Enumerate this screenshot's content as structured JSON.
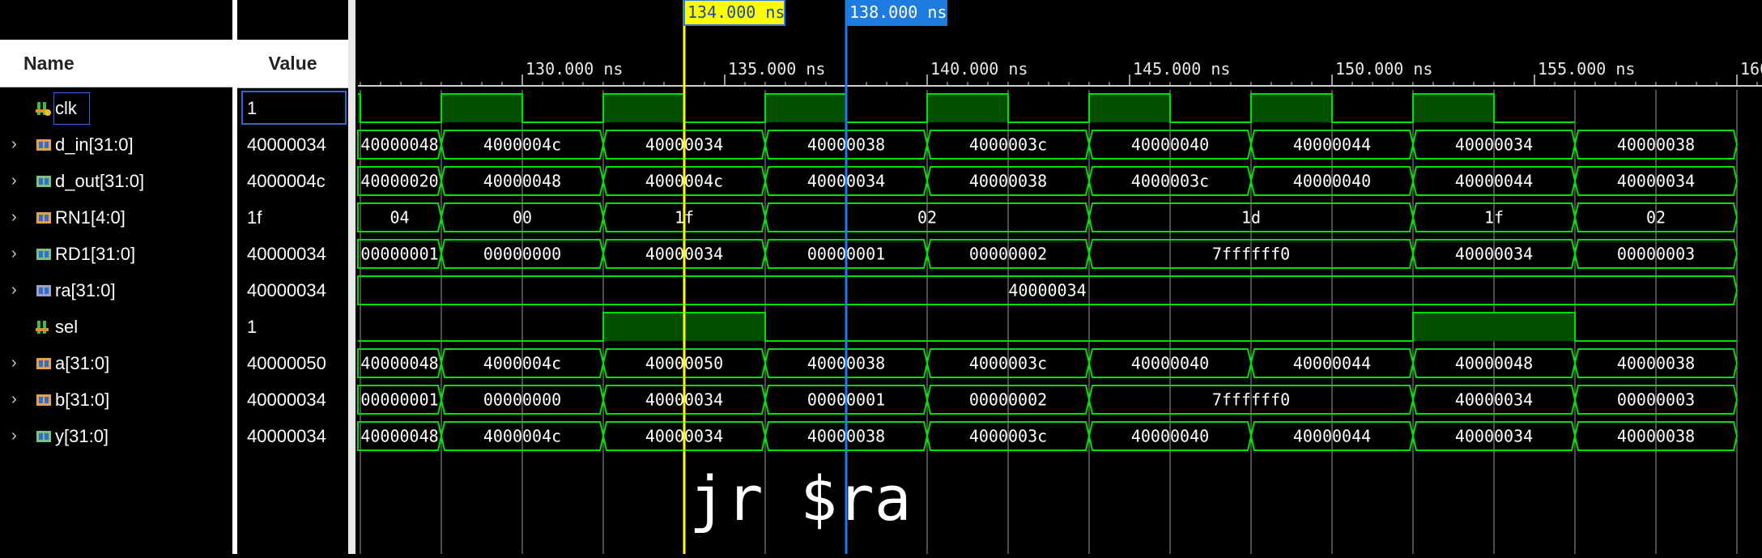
{
  "columns": {
    "name": "Name",
    "value": "Value"
  },
  "signals": [
    {
      "name": "clk",
      "value": "1",
      "icon": "clock-signal-icon",
      "expandable": false,
      "kind": "bit",
      "bits": [
        1,
        0,
        1,
        0,
        1,
        0,
        1,
        0,
        1,
        0,
        1,
        0,
        1,
        0,
        1,
        0,
        1,
        0
      ]
    },
    {
      "name": "d_in[31:0]",
      "value": "40000034",
      "icon": "input-bus-icon",
      "expandable": true,
      "kind": "bus",
      "segments": [
        [
          "40000048",
          120,
          128
        ],
        [
          "4000004c",
          128,
          132
        ],
        [
          "40000034",
          132,
          136
        ],
        [
          "40000038",
          136,
          140
        ],
        [
          "4000003c",
          140,
          144
        ],
        [
          "40000040",
          144,
          148
        ],
        [
          "40000044",
          148,
          152
        ],
        [
          "40000034",
          152,
          156
        ],
        [
          "40000038",
          156,
          160
        ]
      ]
    },
    {
      "name": "d_out[31:0]",
      "value": "4000004c",
      "icon": "output-bus-icon",
      "expandable": true,
      "kind": "bus",
      "segments": [
        [
          "40000020",
          120,
          128
        ],
        [
          "40000048",
          128,
          132
        ],
        [
          "4000004c",
          132,
          136
        ],
        [
          "40000034",
          136,
          140
        ],
        [
          "40000038",
          140,
          144
        ],
        [
          "4000003c",
          144,
          148
        ],
        [
          "40000040",
          148,
          152
        ],
        [
          "40000044",
          152,
          156
        ],
        [
          "40000034",
          156,
          160
        ]
      ]
    },
    {
      "name": "RN1[4:0]",
      "value": "1f",
      "icon": "input-bus-icon",
      "expandable": true,
      "kind": "bus",
      "segments": [
        [
          "04",
          120,
          128
        ],
        [
          "00",
          128,
          132
        ],
        [
          "1f",
          132,
          136
        ],
        [
          "02",
          136,
          144
        ],
        [
          "1d",
          144,
          152
        ],
        [
          "1f",
          152,
          156
        ],
        [
          "02",
          156,
          160
        ]
      ]
    },
    {
      "name": "RD1[31:0]",
      "value": "40000034",
      "icon": "output-bus-icon",
      "expandable": true,
      "kind": "bus",
      "segments": [
        [
          "00000001",
          120,
          128
        ],
        [
          "00000000",
          128,
          132
        ],
        [
          "40000034",
          132,
          136
        ],
        [
          "00000001",
          136,
          140
        ],
        [
          "00000002",
          140,
          144
        ],
        [
          "7ffffff0",
          144,
          152
        ],
        [
          "40000034",
          152,
          156
        ],
        [
          "00000003",
          156,
          160
        ]
      ]
    },
    {
      "name": "ra[31:0]",
      "value": "40000034",
      "icon": "const-bus-icon",
      "expandable": true,
      "kind": "bus",
      "segments": [
        [
          "40000034",
          120,
          160
        ]
      ]
    },
    {
      "name": "sel",
      "value": "1",
      "icon": "bit-signal-icon",
      "expandable": false,
      "kind": "level",
      "levels": [
        [
          0,
          120,
          132
        ],
        [
          1,
          132,
          136
        ],
        [
          0,
          136,
          152
        ],
        [
          1,
          152,
          156
        ],
        [
          0,
          156,
          160
        ]
      ]
    },
    {
      "name": "a[31:0]",
      "value": "40000050",
      "icon": "input-bus-icon",
      "expandable": true,
      "kind": "bus",
      "segments": [
        [
          "40000048",
          120,
          128
        ],
        [
          "4000004c",
          128,
          132
        ],
        [
          "40000050",
          132,
          136
        ],
        [
          "40000038",
          136,
          140
        ],
        [
          "4000003c",
          140,
          144
        ],
        [
          "40000040",
          144,
          148
        ],
        [
          "40000044",
          148,
          152
        ],
        [
          "40000048",
          152,
          156
        ],
        [
          "40000038",
          156,
          160
        ]
      ]
    },
    {
      "name": "b[31:0]",
      "value": "40000034",
      "icon": "input-bus-icon",
      "expandable": true,
      "kind": "bus",
      "segments": [
        [
          "00000001",
          120,
          128
        ],
        [
          "00000000",
          128,
          132
        ],
        [
          "40000034",
          132,
          136
        ],
        [
          "00000001",
          136,
          140
        ],
        [
          "00000002",
          140,
          144
        ],
        [
          "7ffffff0",
          144,
          152
        ],
        [
          "40000034",
          152,
          156
        ],
        [
          "00000003",
          156,
          160
        ]
      ]
    },
    {
      "name": "y[31:0]",
      "value": "40000034",
      "icon": "output-bus-icon",
      "expandable": true,
      "kind": "bus",
      "segments": [
        [
          "40000048",
          120,
          128
        ],
        [
          "4000004c",
          128,
          132
        ],
        [
          "40000034",
          132,
          136
        ],
        [
          "40000038",
          136,
          140
        ],
        [
          "4000003c",
          140,
          144
        ],
        [
          "40000040",
          144,
          148
        ],
        [
          "40000044",
          148,
          152
        ],
        [
          "40000034",
          152,
          156
        ],
        [
          "40000038",
          156,
          160
        ]
      ]
    }
  ],
  "timeline": {
    "ticks": [
      {
        "t": 130,
        "label": "130.000 ns"
      },
      {
        "t": 135,
        "label": "135.000 ns"
      },
      {
        "t": 140,
        "label": "140.000 ns"
      },
      {
        "t": 145,
        "label": "145.000 ns"
      },
      {
        "t": 150,
        "label": "150.000 ns"
      },
      {
        "t": 155,
        "label": "155.000 ns"
      },
      {
        "t": 160,
        "label": "160"
      }
    ]
  },
  "cursors": [
    {
      "t": 134,
      "label": "134.000 ns",
      "color": "#ffff00",
      "label_bg": "#ffff00",
      "label_border": "#2b7de9"
    },
    {
      "t": 138,
      "label": "138.000 ns",
      "color": "#1e7be0",
      "label_bg": "#1e7be0",
      "label_border": "#1e7be0"
    }
  ],
  "annotation": "jr $ra",
  "colors": {
    "wave": "#00e000",
    "fill": "#005000",
    "grid": "#9a9a9a",
    "background": "#000000"
  }
}
